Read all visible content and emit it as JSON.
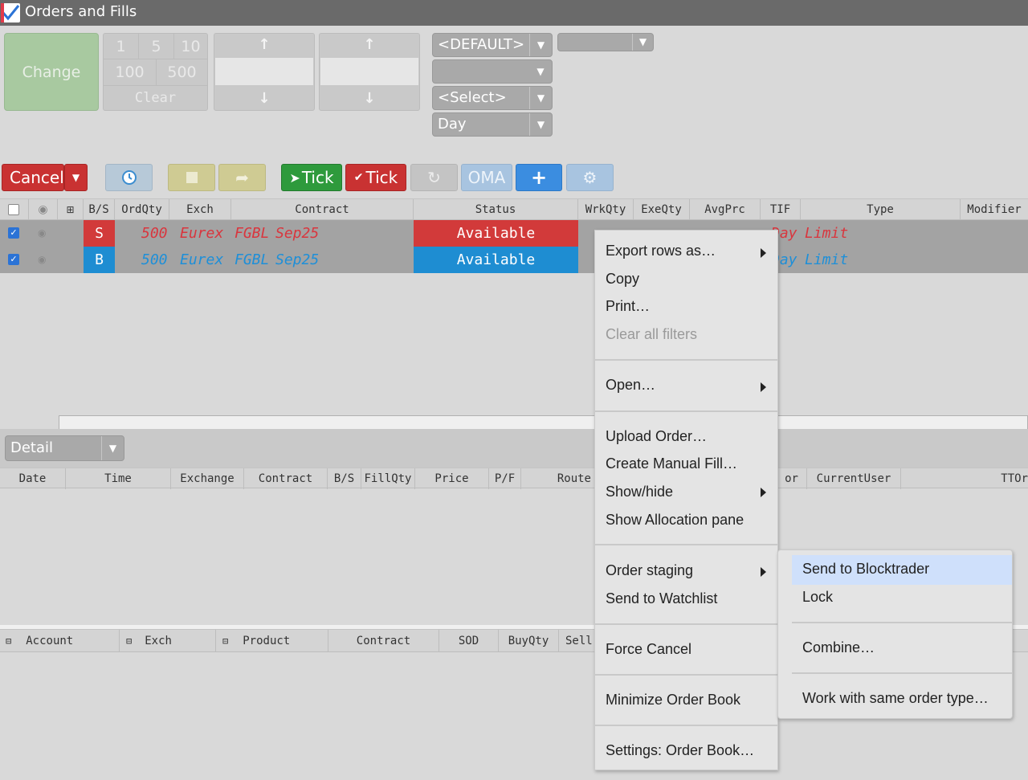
{
  "window": {
    "title": "Orders and Fills"
  },
  "entry": {
    "change_label": "Change",
    "qty_buttons": [
      "1",
      "5",
      "10",
      "100",
      "500"
    ],
    "clear_label": "Clear",
    "account_dropdown": "<DEFAULT>",
    "second_dropdown": "",
    "select_dropdown": "<Select>",
    "tif_dropdown": "Day",
    "extra_dropdown": ""
  },
  "toolbar": {
    "cancel_label": "Cancel",
    "tick_up_label": "Tick",
    "tick_down_label": "Tick",
    "oma_label": "OMA"
  },
  "order_grid": {
    "columns": [
      "B/S",
      "OrdQty",
      "Exch",
      "Contract",
      "Status",
      "WrkQty",
      "ExeQty",
      "AvgPrc",
      "TIF",
      "Type",
      "Modifier"
    ],
    "rows": [
      {
        "side": "S",
        "qty": "500",
        "exch": "Eurex",
        "product": "FGBL",
        "expiry": "Sep25",
        "status": "Available",
        "tif": "Day",
        "type": "Limit",
        "color": "#d9363e",
        "status_bg": "#d23a3a"
      },
      {
        "side": "B",
        "qty": "500",
        "exch": "Eurex",
        "product": "FGBL",
        "expiry": "Sep25",
        "status": "Available",
        "tif": "Day",
        "type": "Limit",
        "color": "#1e8fd8",
        "status_bg": "#1e8dd2"
      }
    ]
  },
  "detail": {
    "dropdown": "Detail",
    "columns": [
      "Date",
      "Time",
      "Exchange",
      "Contract",
      "B/S",
      "FillQty",
      "Price",
      "P/F",
      "Route",
      "or",
      "CurrentUser",
      "TTOr"
    ]
  },
  "positions": {
    "columns": [
      "Account",
      "Exch",
      "Product",
      "Contract",
      "SOD",
      "BuyQty",
      "Sell"
    ]
  },
  "context_menu": {
    "items": [
      "Export rows as…",
      "Copy",
      "Print…",
      "Clear all filters",
      "Open…",
      "Upload Order…",
      "Create Manual Fill…",
      "Show/hide",
      "Show Allocation pane",
      "Order staging",
      "Send to Watchlist",
      "Force Cancel",
      "Minimize Order Book",
      "Settings: Order Book…"
    ]
  },
  "submenu": {
    "items": [
      "Send to Blocktrader",
      "Lock",
      "Combine…",
      "Work with same order type…"
    ]
  }
}
